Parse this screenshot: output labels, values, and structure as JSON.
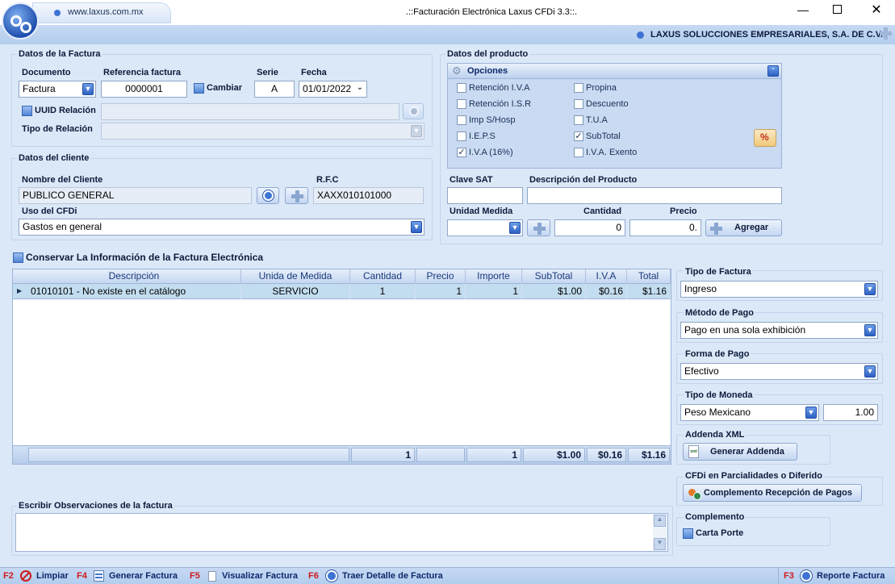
{
  "window": {
    "url": "www.laxus.com.mx",
    "title": ".::Facturación Electrónica Laxus CFDi 3.3::.",
    "company": "LAXUS SOLUCCIONES EMPRESARIALES, S.A. DE C.V."
  },
  "factura": {
    "section_title": "Datos de la Factura",
    "documento_label": "Documento",
    "documento_value": "Factura",
    "referencia_label": "Referencia factura",
    "referencia_value": "0000001",
    "cambiar_label": "Cambiar",
    "serie_label": "Serie",
    "serie_value": "A",
    "fecha_label": "Fecha",
    "fecha_value": "01/01/2022",
    "uuid_label": "UUID Relación",
    "tipo_relacion_label": "Tipo de Relación"
  },
  "cliente": {
    "section_title": "Datos del cliente",
    "nombre_label": "Nombre del Cliente",
    "nombre_value": "PUBLICO GENERAL",
    "rfc_label": "R.F.C",
    "rfc_value": "XAXX010101000",
    "uso_label": "Uso del CFDi",
    "uso_value": "Gastos en general"
  },
  "producto": {
    "section_title": "Datos del producto",
    "opciones_title": "Opciones",
    "options": [
      {
        "label": "Retención I.V.A",
        "checked": false
      },
      {
        "label": "Propina",
        "checked": false
      },
      {
        "label": "Retención I.S.R",
        "checked": false
      },
      {
        "label": "Descuento",
        "checked": false
      },
      {
        "label": "Imp S/Hosp",
        "checked": false
      },
      {
        "label": "T.U.A",
        "checked": false
      },
      {
        "label": "I.E.P.S",
        "checked": false
      },
      {
        "label": "SubTotal",
        "checked": true
      },
      {
        "label": "I.V.A (16%)",
        "checked": true
      },
      {
        "label": "I.V.A. Exento",
        "checked": false
      }
    ],
    "clave_label": "Clave SAT",
    "descripcion_label": "Descripción del Producto",
    "unidad_label": "Unidad Medida",
    "cantidad_label": "Cantidad",
    "cantidad_value": "0",
    "precio_label": "Precio",
    "precio_value": "0.",
    "agregar_label": "Agregar"
  },
  "conservar_label": "Conservar La Información de la Factura Electrónica",
  "grid": {
    "headers": [
      "Descripción",
      "Unida de Medida",
      "Cantidad",
      "Precio",
      "Importe",
      "SubTotal",
      "I.V.A",
      "Total"
    ],
    "rows": [
      [
        "01010101 - No existe en el catálogo",
        "SERVICIO",
        "1",
        "1",
        "1",
        "$1.00",
        "$0.16",
        "$1.16"
      ]
    ],
    "totals": [
      "1",
      "1",
      "$1.00",
      "$0.16",
      "$1.16"
    ]
  },
  "observaciones_label": "Escribir Observaciones de la factura",
  "right": {
    "tipo_factura_label": "Tipo de Factura",
    "tipo_factura_value": "Ingreso",
    "metodo_label": "Método de Pago",
    "metodo_value": "Pago en una sola exhibición",
    "forma_label": "Forma de Pago",
    "forma_value": "Efectivo",
    "moneda_label": "Tipo de Moneda",
    "moneda_value": "Peso Mexicano",
    "tipo_cambio_value": "1.00",
    "addenda_label": "Addenda XML",
    "addenda_button": "Generar Addenda",
    "parcialidades_label": "CFDi en Parcialidades o Diferido",
    "complemento_pagos_button": "Complemento Recepción de Pagos",
    "complemento_label": "Complemento",
    "carta_porte_label": "Carta Porte"
  },
  "footer": {
    "f2": "F2",
    "limpiar": "Limpiar",
    "f4": "F4",
    "generar": "Generar Factura",
    "f5": "F5",
    "visualizar": "Visualizar Factura",
    "f6": "F6",
    "traer": "Traer Detalle de Factura",
    "f3": "F3",
    "reporte": "Reporte Factura"
  }
}
